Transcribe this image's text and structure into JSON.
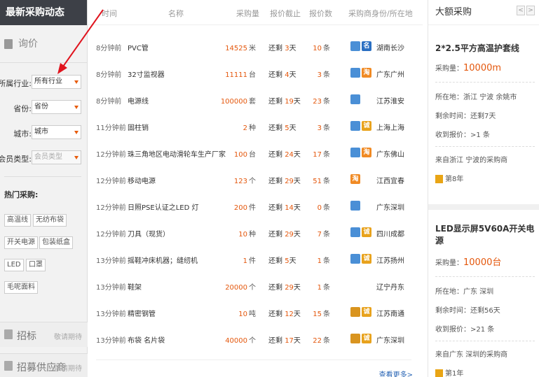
{
  "sidebar": {
    "title": "最新采购动态",
    "inquiry": "询价",
    "filters": [
      {
        "label": "所属行业:",
        "value": "所有行业",
        "disabled": false
      },
      {
        "label": "省份:",
        "value": "省份",
        "disabled": false
      },
      {
        "label": "城市:",
        "value": "城市",
        "disabled": false
      },
      {
        "label": "会员类型:",
        "value": "会员类型",
        "disabled": true
      }
    ],
    "hot_title": "热门采购:",
    "hot_tags": [
      "高温线",
      "无纺布袋",
      "开关电源",
      "包装纸盒",
      "LED",
      "口罩",
      "毛呢面料"
    ],
    "bottom": [
      {
        "title": "招标",
        "sub": "敬请期待"
      },
      {
        "title": "招募供应商",
        "sub": "敬请期待"
      }
    ]
  },
  "table": {
    "headers": [
      "时间",
      "名称",
      "采购量",
      "报价截止",
      "报价数",
      "采购商身份/所在地"
    ],
    "rows": [
      {
        "time": "8分钟前",
        "name": "PVC管",
        "qty": "14525",
        "unit": "米",
        "deadline_pre": "还剩",
        "deadline_n": "3",
        "deadline_u": "天",
        "bids": "10",
        "bids_u": "条",
        "badges": [
          "b1",
          "b2"
        ],
        "location": "湖南长沙"
      },
      {
        "time": "8分钟前",
        "name": "32寸监视器",
        "qty": "11111",
        "unit": "台",
        "deadline_pre": "还剩",
        "deadline_n": "4",
        "deadline_u": "天",
        "bids": "3",
        "bids_u": "条",
        "badges": [
          "b1",
          "b3"
        ],
        "location": "广东广州"
      },
      {
        "time": "8分钟前",
        "name": "电源线",
        "qty": "100000",
        "unit": "套",
        "deadline_pre": "还剩",
        "deadline_n": "19",
        "deadline_u": "天",
        "bids": "23",
        "bids_u": "条",
        "badges": [
          "b1"
        ],
        "location": "江苏淮安"
      },
      {
        "time": "11分钟前",
        "name": "固柱销",
        "qty": "2",
        "unit": "种",
        "deadline_pre": "还剩",
        "deadline_n": "5",
        "deadline_u": "天",
        "bids": "3",
        "bids_u": "条",
        "badges": [
          "b1",
          "b4"
        ],
        "location": "上海上海"
      },
      {
        "time": "12分钟前",
        "name": "珠三角地区电动滑轮车生产厂家",
        "qty": "100",
        "unit": "台",
        "deadline_pre": "还剩",
        "deadline_n": "24",
        "deadline_u": "天",
        "bids": "17",
        "bids_u": "条",
        "badges": [
          "b1",
          "b3"
        ],
        "location": "广东佛山"
      },
      {
        "time": "12分钟前",
        "name": "移动电源",
        "qty": "123",
        "unit": "个",
        "deadline_pre": "还剩",
        "deadline_n": "29",
        "deadline_u": "天",
        "bids": "51",
        "bids_u": "条",
        "badges": [
          "b3"
        ],
        "location": "江西宜春"
      },
      {
        "time": "12分钟前",
        "name": "日照PSE认证之LED 灯",
        "qty": "200",
        "unit": "件",
        "deadline_pre": "还剩",
        "deadline_n": "14",
        "deadline_u": "天",
        "bids": "0",
        "bids_u": "条",
        "badges": [
          "b1"
        ],
        "location": "广东深圳"
      },
      {
        "time": "12分钟前",
        "name": "刀具（现货）",
        "qty": "10",
        "unit": "种",
        "deadline_pre": "还剩",
        "deadline_n": "29",
        "deadline_u": "天",
        "bids": "7",
        "bids_u": "条",
        "badges": [
          "b1",
          "b4"
        ],
        "location": "四川成都"
      },
      {
        "time": "13分钟前",
        "name": "摇鞋冲床机器；缝纫机",
        "qty": "1",
        "unit": "件",
        "deadline_pre": "还剩",
        "deadline_n": "5",
        "deadline_u": "天",
        "bids": "1",
        "bids_u": "条",
        "badges": [
          "b1",
          "b4"
        ],
        "location": "江苏扬州"
      },
      {
        "time": "13分钟前",
        "name": "鞋架",
        "qty": "20000",
        "unit": "个",
        "deadline_pre": "还剩",
        "deadline_n": "29",
        "deadline_u": "天",
        "bids": "1",
        "bids_u": "条",
        "badges": [],
        "location": "辽宁丹东"
      },
      {
        "time": "13分钟前",
        "name": "精密钢管",
        "qty": "10",
        "unit": "吨",
        "deadline_pre": "还剩",
        "deadline_n": "12",
        "deadline_u": "天",
        "bids": "15",
        "bids_u": "条",
        "badges": [
          "b5",
          "b4"
        ],
        "location": "江苏南通"
      },
      {
        "time": "13分钟前",
        "name": "布袋 名片袋",
        "qty": "40000",
        "unit": "个",
        "deadline_pre": "还剩",
        "deadline_n": "17",
        "deadline_u": "天",
        "bids": "22",
        "bids_u": "条",
        "badges": [
          "b5",
          "b4"
        ],
        "location": "广东深圳"
      }
    ],
    "more": "查看更多>"
  },
  "right": {
    "title": "大额采购",
    "prev": "<",
    "next": ">",
    "cards": [
      {
        "title": "2*2.5平方高温护套线",
        "qty_label": "采购量：",
        "qty_value": "10000m",
        "location": "所在地：浙江 宁波 余姚市",
        "remaining": "剩余时间：还剩7天",
        "bids": "收到报价：>1 条",
        "from": "来自浙江 宁波的采购商",
        "years": "第8年"
      },
      {
        "title": "LED显示屏5V60A开关电源",
        "qty_label": "采购量：",
        "qty_value": "10000台",
        "location": "所在地：广东 深圳",
        "remaining": "剩余时间：还剩56天",
        "bids": "收到报价：>21 条",
        "from": "来自广东 深圳的采购商",
        "years": "第1年"
      }
    ]
  },
  "colors": {
    "accent": "#e4570c",
    "header_dark": "#3d4047",
    "link": "#2a66b5",
    "annotation_arrow": "#e0141e"
  }
}
